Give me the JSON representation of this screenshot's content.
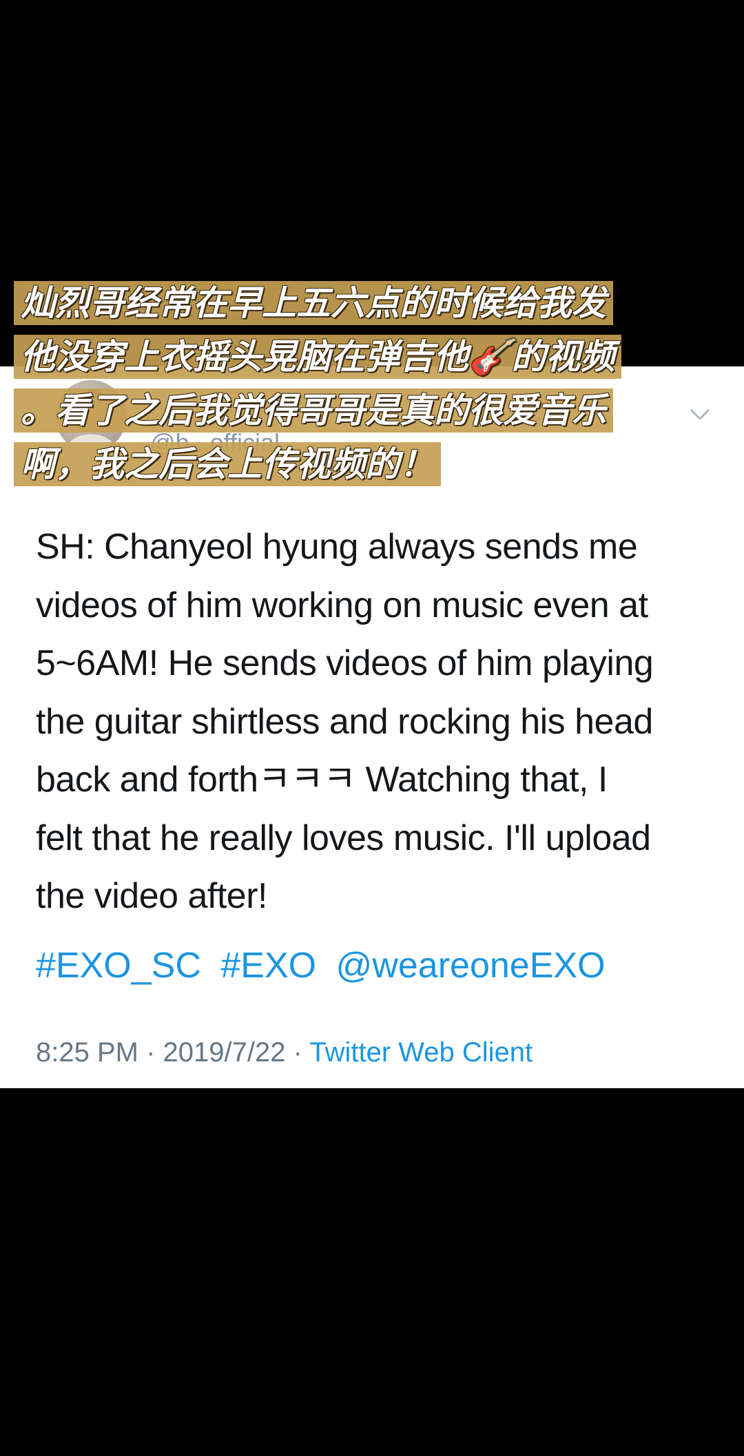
{
  "overlay_caption": {
    "lines": [
      "灿烈哥经常在早上五六点的时候给我发",
      "他没穿上衣摇头晃脑在弹吉他🎸的视频",
      "。看了之后我觉得哥哥是真的很爱音乐",
      "啊，我之后会上传视频的！"
    ],
    "highlight_color": "#c6a054"
  },
  "tweet": {
    "handle_partial": "@h...official",
    "text_lines": [
      "SH: Chanyeol hyung always sends me",
      "videos of him working on music even at",
      "5~6AM! He sends videos of him playing",
      "the guitar shirtless and rocking his head",
      "back and forthㅋㅋㅋ Watching that, I",
      "felt that he really loves music. I'll upload",
      "the video after!"
    ],
    "tags": [
      "#EXO_SC",
      "#EXO",
      "@weareoneEXO"
    ],
    "time": "8:25 PM",
    "date": "2019/7/22",
    "separator": "·",
    "client": "Twitter Web Client"
  },
  "icons": {
    "menu": "chevron-down-icon",
    "avatar": "avatar-image"
  },
  "colors": {
    "link": "#1b95e0",
    "meta": "#657786",
    "text": "#14171a"
  }
}
